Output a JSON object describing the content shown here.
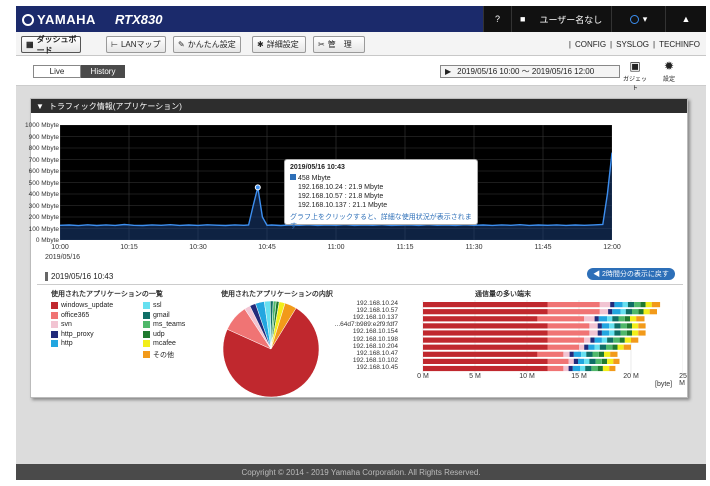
{
  "header": {
    "brand": "YAMAHA",
    "model": "RTX830",
    "help": "?",
    "user": "ユーザー名なし"
  },
  "nav": {
    "buttons": [
      "ダッシュボード",
      "LANマップ",
      "かんたん設定",
      "詳細設定",
      "管　理"
    ],
    "links": [
      "CONFIG",
      "SYSLOG",
      "TECHINFO"
    ]
  },
  "subbar": {
    "live": "Live",
    "history": "History",
    "range": "2019/05/16 10:00 ～ 2019/05/16 12:00",
    "gadget": "ガジェット",
    "settings": "設定"
  },
  "panel": {
    "title": "トラフィック情報(アプリケーション)"
  },
  "traffic": {
    "y_labels": [
      "1000 Mbyte",
      "900 Mbyte",
      "800 Mbyte",
      "700 Mbyte",
      "600 Mbyte",
      "500 Mbyte",
      "400 Mbyte",
      "300 Mbyte",
      "200 Mbyte",
      "100 Mbyte",
      "0 Mbyte"
    ],
    "x_labels": [
      "10:00",
      "10:15",
      "10:30",
      "10:45",
      "11:00",
      "11:15",
      "11:30",
      "11:45",
      "12:00"
    ],
    "x_date": "2019/05/16",
    "tooltip": {
      "title": "2019/05/16 10:43",
      "total": "458 Mbyte",
      "lines": [
        "192.168.10.24 : 21.9 Mbyte",
        "192.168.10.57 : 21.8 Mbyte",
        "192.168.10.137 : 21.1 Mbyte"
      ],
      "hint": "グラフ上をクリックすると、詳細な使用状況が表示されます"
    },
    "selected_time": "2019/05/16 10:43",
    "back_button": "◀ 2時間分の表示に戻す"
  },
  "apps": {
    "title": "使用されたアプリケーションの一覧",
    "items": [
      {
        "name": "windows_update",
        "color": "#c0282e"
      },
      {
        "name": "office365",
        "color": "#f07474"
      },
      {
        "name": "svn",
        "color": "#f2c4d2"
      },
      {
        "name": "http_proxy",
        "color": "#222a7a"
      },
      {
        "name": "http",
        "color": "#22a6e0"
      },
      {
        "name": "ssl",
        "color": "#66e0f0"
      },
      {
        "name": "gmail",
        "color": "#0e6e66"
      },
      {
        "name": "ms_teams",
        "color": "#4fb86a"
      },
      {
        "name": "udp",
        "color": "#1f7a2e"
      },
      {
        "name": "mcafee",
        "color": "#f2ee1a"
      },
      {
        "name": "その他",
        "color": "#f29a1a"
      }
    ]
  },
  "pie": {
    "title": "使用されたアプリケーションの内訳"
  },
  "hosts": {
    "title": "通信量の多い端末",
    "items": [
      "192.168.10.24",
      "192.168.10.57",
      "192.168.10.137",
      "...64d7:b989:e2f9:fdf7",
      "192.168.10.154",
      "192.168.10.198",
      "192.168.10.204",
      "192.168.10.47",
      "192.168.10.102",
      "192.168.10.45"
    ],
    "x_labels": [
      "0 M",
      "5 M",
      "10 M",
      "15 M",
      "20 M",
      "25 M"
    ],
    "unit": "[byte]"
  },
  "footer": "Copyright © 2014 - 2019 Yamaha Corporation. All Rights Reserved.",
  "chart_data": [
    {
      "type": "line",
      "x": [
        "10:00",
        "10:15",
        "10:30",
        "10:45",
        "11:00",
        "11:15",
        "11:30",
        "11:45",
        "12:00"
      ],
      "xlabel": "2019/05/16",
      "ylabel": "",
      "ylim": [
        0,
        1000
      ],
      "series": [
        {
          "values": [
            [
              0,
              128
            ],
            [
              2,
              130
            ],
            [
              4,
              125
            ],
            [
              6,
              132
            ],
            [
              8,
              126
            ],
            [
              10,
              131
            ],
            [
              12,
              127
            ],
            [
              14,
              135
            ],
            [
              16,
              128
            ],
            [
              18,
              126
            ],
            [
              20,
              131
            ],
            [
              22,
              128
            ],
            [
              24,
              133
            ],
            [
              26,
              127
            ],
            [
              28,
              130
            ],
            [
              30,
              127
            ],
            [
              32,
              132
            ],
            [
              34,
              129
            ],
            [
              36,
              126
            ],
            [
              38,
              131
            ],
            [
              40,
              128
            ],
            [
              41,
              130
            ],
            [
              42,
              300
            ],
            [
              43,
              458
            ],
            [
              44,
              200
            ],
            [
              45,
              128
            ],
            [
              46,
              130
            ],
            [
              48,
              126
            ],
            [
              50,
              131
            ],
            [
              52,
              128
            ],
            [
              54,
              132
            ],
            [
              56,
              127
            ],
            [
              58,
              130
            ],
            [
              60,
              128
            ],
            [
              62,
              133
            ],
            [
              64,
              127
            ],
            [
              66,
              130
            ],
            [
              68,
              128
            ],
            [
              70,
              132
            ],
            [
              72,
              127
            ],
            [
              74,
              129
            ],
            [
              76,
              131
            ],
            [
              78,
              127
            ],
            [
              80,
              133
            ],
            [
              82,
              128
            ],
            [
              84,
              130
            ],
            [
              86,
              127
            ],
            [
              88,
              132
            ],
            [
              90,
              128
            ],
            [
              92,
              130
            ],
            [
              94,
              127
            ],
            [
              96,
              131
            ],
            [
              98,
              128
            ],
            [
              100,
              133
            ],
            [
              102,
              127
            ],
            [
              104,
              130
            ],
            [
              106,
              128
            ],
            [
              108,
              131
            ],
            [
              110,
              127
            ],
            [
              112,
              130
            ],
            [
              114,
              128
            ],
            [
              116,
              131
            ],
            [
              118,
              135
            ],
            [
              119,
              400
            ],
            [
              120,
              760
            ]
          ]
        }
      ],
      "note_x_units": "minutes after 10:00"
    },
    {
      "type": "pie",
      "title": "使用されたアプリケーションの内訳",
      "categories": [
        "windows_update",
        "office365",
        "svn",
        "http_proxy",
        "http",
        "ssl",
        "gmail",
        "ms_teams",
        "udp",
        "mcafee",
        "その他"
      ],
      "values": [
        73,
        9,
        2,
        2,
        3,
        2,
        1,
        1,
        1,
        2,
        4
      ]
    },
    {
      "type": "bar",
      "title": "通信量の多い端末",
      "orientation": "horizontal",
      "categories": [
        "192.168.10.24",
        "192.168.10.57",
        "192.168.10.137",
        "...64d7:b989:e2f9:fdf7",
        "192.168.10.154",
        "192.168.10.198",
        "192.168.10.204",
        "192.168.10.47",
        "192.168.10.102",
        "192.168.10.45"
      ],
      "xlim": [
        0,
        25
      ],
      "xlabel": "[byte]",
      "series": [
        {
          "name": "windows_update",
          "values": [
            12,
            12,
            11,
            12,
            12,
            12,
            12,
            11,
            12,
            12
          ]
        },
        {
          "name": "office365",
          "values": [
            5.0,
            5.0,
            4.5,
            4.0,
            4.0,
            3.5,
            3.0,
            2.5,
            2.0,
            1.5
          ]
        },
        {
          "name": "svn",
          "values": [
            1.0,
            0.8,
            1.0,
            0.8,
            0.8,
            0.6,
            0.5,
            0.6,
            0.5,
            0.5
          ]
        },
        {
          "name": "http_proxy",
          "values": [
            0.4,
            0.4,
            0.4,
            0.4,
            0.4,
            0.4,
            0.4,
            0.4,
            0.4,
            0.4
          ]
        },
        {
          "name": "http",
          "values": [
            0.8,
            0.8,
            0.8,
            0.7,
            0.7,
            0.7,
            0.6,
            0.7,
            0.6,
            0.7
          ]
        },
        {
          "name": "ssl",
          "values": [
            0.5,
            0.5,
            0.5,
            0.5,
            0.5,
            0.5,
            0.5,
            0.5,
            0.5,
            0.5
          ]
        },
        {
          "name": "gmail",
          "values": [
            0.6,
            0.6,
            0.6,
            0.6,
            0.6,
            0.6,
            0.6,
            0.6,
            0.6,
            0.6
          ]
        },
        {
          "name": "ms_teams",
          "values": [
            0.6,
            0.6,
            0.6,
            0.6,
            0.6,
            0.6,
            0.6,
            0.6,
            0.6,
            0.6
          ]
        },
        {
          "name": "udp",
          "values": [
            0.5,
            0.5,
            0.5,
            0.5,
            0.5,
            0.5,
            0.5,
            0.5,
            0.5,
            0.5
          ]
        },
        {
          "name": "mcafee",
          "values": [
            0.6,
            0.6,
            0.6,
            0.6,
            0.6,
            0.6,
            0.6,
            0.6,
            0.6,
            0.6
          ]
        },
        {
          "name": "その他",
          "values": [
            0.8,
            0.7,
            0.8,
            0.7,
            0.7,
            0.7,
            0.7,
            0.7,
            0.6,
            0.6
          ]
        }
      ]
    }
  ]
}
